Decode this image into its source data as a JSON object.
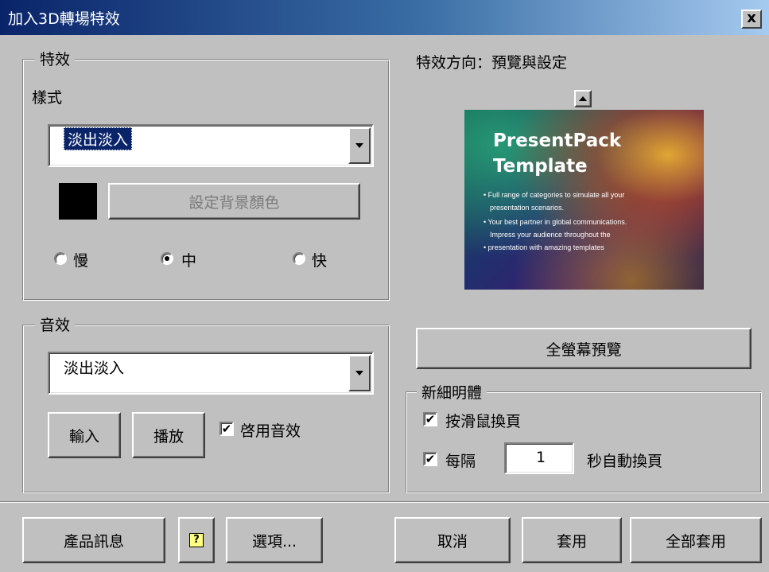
{
  "window": {
    "title": "加入3D轉場特效",
    "close_label": "x"
  },
  "effect_group": {
    "legend": "特效",
    "style_label": "樣式",
    "style_value": "淡出淡入",
    "bg_color_swatch": "#000000",
    "bg_color_button": "設定背景顏色",
    "speed_options": [
      {
        "label": "慢",
        "selected": false
      },
      {
        "label": "中",
        "selected": true
      },
      {
        "label": "快",
        "selected": false
      }
    ]
  },
  "sound_group": {
    "legend": "音效",
    "sound_value": "淡出淡入",
    "import_button": "輸入",
    "play_button": "播放",
    "enable_sound_label": "啓用音效",
    "enable_sound_checked": true
  },
  "preview": {
    "heading": "特效方向：預覽與設定",
    "slide_title_1": "PresentPack",
    "slide_title_2": "Template",
    "slide_bullets": [
      "• Full range of categories to simulate all your",
      "presentation scenarios.",
      "• Your best partner in global communications.",
      "Impress your audience throughout the",
      "• presentation with amazing templates"
    ],
    "fullscreen_button": "全螢幕預覽"
  },
  "page_turn_group": {
    "legend": "新細明體",
    "mouse_label": "按滑鼠換頁",
    "mouse_checked": true,
    "every_label": "每隔",
    "every_checked": true,
    "seconds_value": "1",
    "auto_label": "秒自動換頁"
  },
  "footer": {
    "product_info": "產品訊息",
    "help_icon": "help-icon",
    "options": "選項...",
    "cancel": "取消",
    "apply": "套用",
    "apply_all": "全部套用"
  }
}
